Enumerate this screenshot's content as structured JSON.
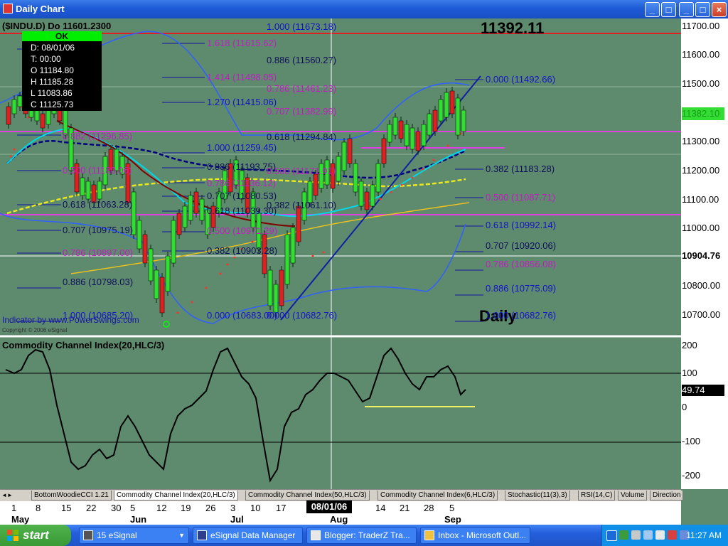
{
  "window": {
    "title": "Daily Chart",
    "controls": [
      "_",
      "□",
      "×"
    ]
  },
  "chart": {
    "symbol_label": "($INDU.D) Do 11601.2300",
    "big_price": "11392.11",
    "watermark": "Daily",
    "indicator_credit": "Indicator by www.PowerSwings.com",
    "copyright": "Copyright © 2006 eSignal",
    "infobox": {
      "status": "OK",
      "date": "D: 08/01/06",
      "time": "T: 00:00",
      "open": "O 11184.80",
      "high": "H 11185.28",
      "low": "L 11083.86",
      "close": "C 11125.73"
    },
    "price_axis": {
      "ticks": [
        "11700.00",
        "11600.00",
        "11500.00",
        "11400.00",
        "11300.00",
        "11200.00",
        "11100.00",
        "11000.00",
        "10900.00",
        "10800.00",
        "10700.00"
      ],
      "cursor_price": "10904.76",
      "last_price": "11382.10"
    },
    "fib_levels_left": [
      {
        "label": "1.618 (11615.62)",
        "color": "magenta"
      },
      {
        "label": "1.414 (11498.05)",
        "color": "magenta"
      },
      {
        "label": "0.882 (11296.85)",
        "color": "magenta"
      },
      {
        "label": "0.500 (11180.06)",
        "color": "magenta"
      },
      {
        "label": "0.618 (11063.28)",
        "color": "navy"
      },
      {
        "label": "0.707 (10975.19)",
        "color": "navy"
      },
      {
        "label": "0.786 (10897.00)",
        "color": "magenta"
      },
      {
        "label": "0.886 (10798.03)",
        "color": "navy"
      },
      {
        "label": "1.000 (10685.20)",
        "color": "blue"
      }
    ],
    "fib_levels_middle": [
      {
        "label": "1.000 (11673.18)",
        "color": "blue"
      },
      {
        "label": "0.886 (11560.27)",
        "color": "navy"
      },
      {
        "label": "1.270 (11415.06)",
        "color": "blue"
      },
      {
        "label": "0.786 (11461.23)",
        "color": "magenta"
      },
      {
        "label": "0.707 (11382.99)",
        "color": "magenta"
      },
      {
        "label": "0.618 (11294.84)",
        "color": "navy"
      },
      {
        "label": "1.000 (11259.45)",
        "color": "blue"
      },
      {
        "label": "0.886 (11193.75)",
        "color": "navy"
      },
      {
        "label": "0.500 (11171.91)",
        "color": "magenta"
      },
      {
        "label": "0.786 (11136.12)",
        "color": "magenta"
      },
      {
        "label": "0.707 (11080.53)",
        "color": "navy"
      },
      {
        "label": "0.618 (11039.30)",
        "color": "navy"
      },
      {
        "label": "0.382 (11061.10)",
        "color": "navy"
      },
      {
        "label": "0.500 (10971.29)",
        "color": "magenta"
      },
      {
        "label": "0.382 (10903.28)",
        "color": "navy"
      },
      {
        "label": "0.000 (10683.00)",
        "color": "blue"
      },
      {
        "label": "0.000 (10682.76)",
        "color": "blue"
      }
    ],
    "fib_levels_right": [
      {
        "label": "0.000 (11492.66)",
        "color": "blue"
      },
      {
        "label": "0.382 (11183.28)",
        "color": "navy"
      },
      {
        "label": "0.500 (11087.71)",
        "color": "magenta"
      },
      {
        "label": "0.618 (10992.14)",
        "color": "blue"
      },
      {
        "label": "0.707 (10920.06)",
        "color": "navy"
      },
      {
        "label": "0.786 (10856.08)",
        "color": "magenta"
      },
      {
        "label": "0.886 (10775.09)",
        "color": "blue"
      },
      {
        "label": "1.000 (10682.76)",
        "color": "blue"
      }
    ]
  },
  "cci_panel": {
    "title": "Commodity Channel Index(20,HLC/3)",
    "current_value": "49.74",
    "ticks": [
      "200",
      "100",
      "0",
      "-100",
      "-200"
    ]
  },
  "tabs": [
    {
      "label": "BottomWoodieCCI 1.21",
      "active": false
    },
    {
      "label": "Commodity Channel Index(20,HLC/3)",
      "active": true
    },
    {
      "label": "Commodity Channel Index(50,HLC/3)",
      "active": false
    },
    {
      "label": "Commodity Channel Index(6,HLC/3)",
      "active": false
    },
    {
      "label": "Stochastic(11(3),3)",
      "active": false
    },
    {
      "label": "RSI(14,C)",
      "active": false
    },
    {
      "label": "Volume",
      "active": false
    },
    {
      "label": "Direction",
      "active": false
    }
  ],
  "date_axis": {
    "days": [
      "1",
      "8",
      "15",
      "22",
      "30",
      "5",
      "12",
      "19",
      "26",
      "3",
      "10",
      "17",
      "24",
      "31",
      "7",
      "14",
      "21",
      "28",
      "5"
    ],
    "months": [
      "May",
      "Jun",
      "Jul",
      "Aug",
      "Sep"
    ],
    "cursor_date": "08/01/06"
  },
  "taskbar": {
    "start_label": "start",
    "buttons": [
      {
        "label": "15 eSignal"
      },
      {
        "label": "eSignal Data Manager"
      },
      {
        "label": "Blogger: TraderZ Tra..."
      },
      {
        "label": "Inbox - Microsoft Outl..."
      }
    ],
    "clock": "11:27 AM"
  }
}
